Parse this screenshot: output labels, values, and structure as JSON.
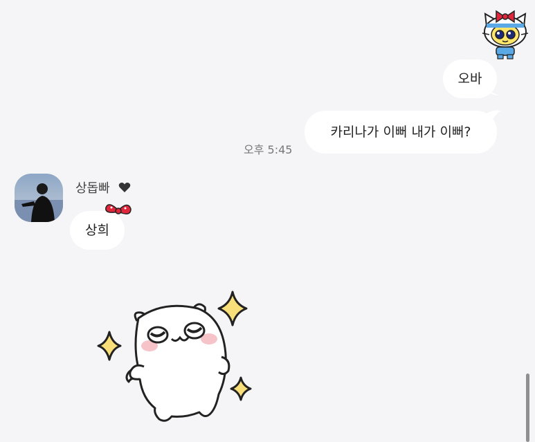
{
  "messages": {
    "sent": [
      {
        "text": "오바"
      },
      {
        "text": "카리나가 이뻐 내가 이뻐?"
      }
    ],
    "sent_time": "오후 5:45",
    "received": {
      "sender_name": "상돕빠",
      "text": "상희"
    }
  },
  "icons": {
    "my_profile_sticker": "hello-kitty-tamagotchi-icon",
    "sender_heart": "heart-icon",
    "bubble_decoration": "red-ribbon-bow-icon",
    "sticker": "hamster-sparkle-sticker"
  },
  "colors": {
    "background": "#f5f5f7",
    "bubble": "#ffffff",
    "text": "#222222",
    "timestamp": "#777777",
    "bow_red": "#e0263a",
    "sparkle_yellow": "#f9df7a"
  }
}
